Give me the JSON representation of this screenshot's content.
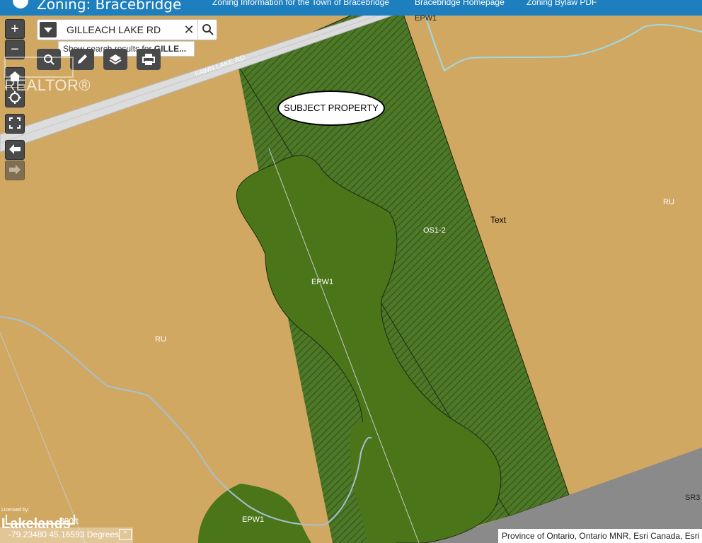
{
  "header": {
    "title": "Zoning: Bracebridge",
    "links": [
      "Zoning Information for the Town of Bracebridge",
      "Bracebridge Homepage",
      "Zoning Bylaw PDF"
    ]
  },
  "zoom": {
    "in": "+",
    "out": "−"
  },
  "search": {
    "value": "GILLEACH LAKE RD",
    "suggestion_prefix": "Show search results for",
    "suggestion_term": "GILLE..."
  },
  "watermark": "REALTOR®",
  "map": {
    "road_label": "FAWN LAKE RD",
    "subject_label": "SUBJECT PROPERTY",
    "zone_labels": {
      "ru_main": "RU",
      "ru_east": "RU",
      "os": "OS1-2",
      "epw_center": "EPW1",
      "epw_bottom": "EPW1",
      "epw_top": "EPW1",
      "sr": "SR3",
      "text_marker": "Text"
    },
    "colors": {
      "rural": "#d1a862",
      "wetland": "#4a7519",
      "open_space_hatch": "#4d7828",
      "residential": "#8a8a8a",
      "stream": "#9fd9e6",
      "trail": "#a7c0d4"
    }
  },
  "footer": {
    "attribution": "Province of Ontario, Ontario MNR, Esri Canada, Esri",
    "coordinates": "-79.23480 45.16593 Degrees",
    "scale": "300ft",
    "licensed_by": "Licensed by:",
    "brand": "Lakelands"
  }
}
